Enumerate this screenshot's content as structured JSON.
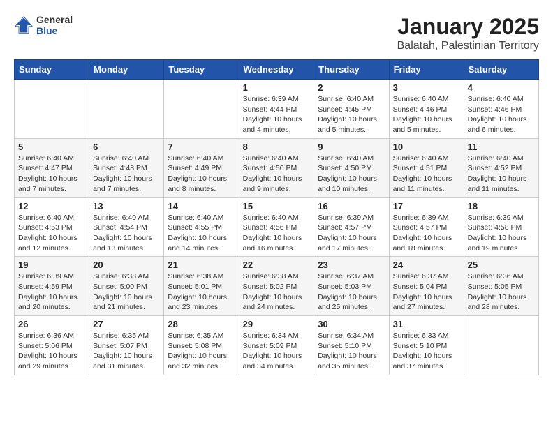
{
  "header": {
    "logo_general": "General",
    "logo_blue": "Blue",
    "title": "January 2025",
    "subtitle": "Balatah, Palestinian Territory"
  },
  "weekdays": [
    "Sunday",
    "Monday",
    "Tuesday",
    "Wednesday",
    "Thursday",
    "Friday",
    "Saturday"
  ],
  "weeks": [
    [
      {
        "day": "",
        "info": ""
      },
      {
        "day": "",
        "info": ""
      },
      {
        "day": "",
        "info": ""
      },
      {
        "day": "1",
        "info": "Sunrise: 6:39 AM\nSunset: 4:44 PM\nDaylight: 10 hours\nand 4 minutes."
      },
      {
        "day": "2",
        "info": "Sunrise: 6:40 AM\nSunset: 4:45 PM\nDaylight: 10 hours\nand 5 minutes."
      },
      {
        "day": "3",
        "info": "Sunrise: 6:40 AM\nSunset: 4:46 PM\nDaylight: 10 hours\nand 5 minutes."
      },
      {
        "day": "4",
        "info": "Sunrise: 6:40 AM\nSunset: 4:46 PM\nDaylight: 10 hours\nand 6 minutes."
      }
    ],
    [
      {
        "day": "5",
        "info": "Sunrise: 6:40 AM\nSunset: 4:47 PM\nDaylight: 10 hours\nand 7 minutes."
      },
      {
        "day": "6",
        "info": "Sunrise: 6:40 AM\nSunset: 4:48 PM\nDaylight: 10 hours\nand 7 minutes."
      },
      {
        "day": "7",
        "info": "Sunrise: 6:40 AM\nSunset: 4:49 PM\nDaylight: 10 hours\nand 8 minutes."
      },
      {
        "day": "8",
        "info": "Sunrise: 6:40 AM\nSunset: 4:50 PM\nDaylight: 10 hours\nand 9 minutes."
      },
      {
        "day": "9",
        "info": "Sunrise: 6:40 AM\nSunset: 4:50 PM\nDaylight: 10 hours\nand 10 minutes."
      },
      {
        "day": "10",
        "info": "Sunrise: 6:40 AM\nSunset: 4:51 PM\nDaylight: 10 hours\nand 11 minutes."
      },
      {
        "day": "11",
        "info": "Sunrise: 6:40 AM\nSunset: 4:52 PM\nDaylight: 10 hours\nand 11 minutes."
      }
    ],
    [
      {
        "day": "12",
        "info": "Sunrise: 6:40 AM\nSunset: 4:53 PM\nDaylight: 10 hours\nand 12 minutes."
      },
      {
        "day": "13",
        "info": "Sunrise: 6:40 AM\nSunset: 4:54 PM\nDaylight: 10 hours\nand 13 minutes."
      },
      {
        "day": "14",
        "info": "Sunrise: 6:40 AM\nSunset: 4:55 PM\nDaylight: 10 hours\nand 14 minutes."
      },
      {
        "day": "15",
        "info": "Sunrise: 6:40 AM\nSunset: 4:56 PM\nDaylight: 10 hours\nand 16 minutes."
      },
      {
        "day": "16",
        "info": "Sunrise: 6:39 AM\nSunset: 4:57 PM\nDaylight: 10 hours\nand 17 minutes."
      },
      {
        "day": "17",
        "info": "Sunrise: 6:39 AM\nSunset: 4:57 PM\nDaylight: 10 hours\nand 18 minutes."
      },
      {
        "day": "18",
        "info": "Sunrise: 6:39 AM\nSunset: 4:58 PM\nDaylight: 10 hours\nand 19 minutes."
      }
    ],
    [
      {
        "day": "19",
        "info": "Sunrise: 6:39 AM\nSunset: 4:59 PM\nDaylight: 10 hours\nand 20 minutes."
      },
      {
        "day": "20",
        "info": "Sunrise: 6:38 AM\nSunset: 5:00 PM\nDaylight: 10 hours\nand 21 minutes."
      },
      {
        "day": "21",
        "info": "Sunrise: 6:38 AM\nSunset: 5:01 PM\nDaylight: 10 hours\nand 23 minutes."
      },
      {
        "day": "22",
        "info": "Sunrise: 6:38 AM\nSunset: 5:02 PM\nDaylight: 10 hours\nand 24 minutes."
      },
      {
        "day": "23",
        "info": "Sunrise: 6:37 AM\nSunset: 5:03 PM\nDaylight: 10 hours\nand 25 minutes."
      },
      {
        "day": "24",
        "info": "Sunrise: 6:37 AM\nSunset: 5:04 PM\nDaylight: 10 hours\nand 27 minutes."
      },
      {
        "day": "25",
        "info": "Sunrise: 6:36 AM\nSunset: 5:05 PM\nDaylight: 10 hours\nand 28 minutes."
      }
    ],
    [
      {
        "day": "26",
        "info": "Sunrise: 6:36 AM\nSunset: 5:06 PM\nDaylight: 10 hours\nand 29 minutes."
      },
      {
        "day": "27",
        "info": "Sunrise: 6:35 AM\nSunset: 5:07 PM\nDaylight: 10 hours\nand 31 minutes."
      },
      {
        "day": "28",
        "info": "Sunrise: 6:35 AM\nSunset: 5:08 PM\nDaylight: 10 hours\nand 32 minutes."
      },
      {
        "day": "29",
        "info": "Sunrise: 6:34 AM\nSunset: 5:09 PM\nDaylight: 10 hours\nand 34 minutes."
      },
      {
        "day": "30",
        "info": "Sunrise: 6:34 AM\nSunset: 5:10 PM\nDaylight: 10 hours\nand 35 minutes."
      },
      {
        "day": "31",
        "info": "Sunrise: 6:33 AM\nSunset: 5:10 PM\nDaylight: 10 hours\nand 37 minutes."
      },
      {
        "day": "",
        "info": ""
      }
    ]
  ]
}
